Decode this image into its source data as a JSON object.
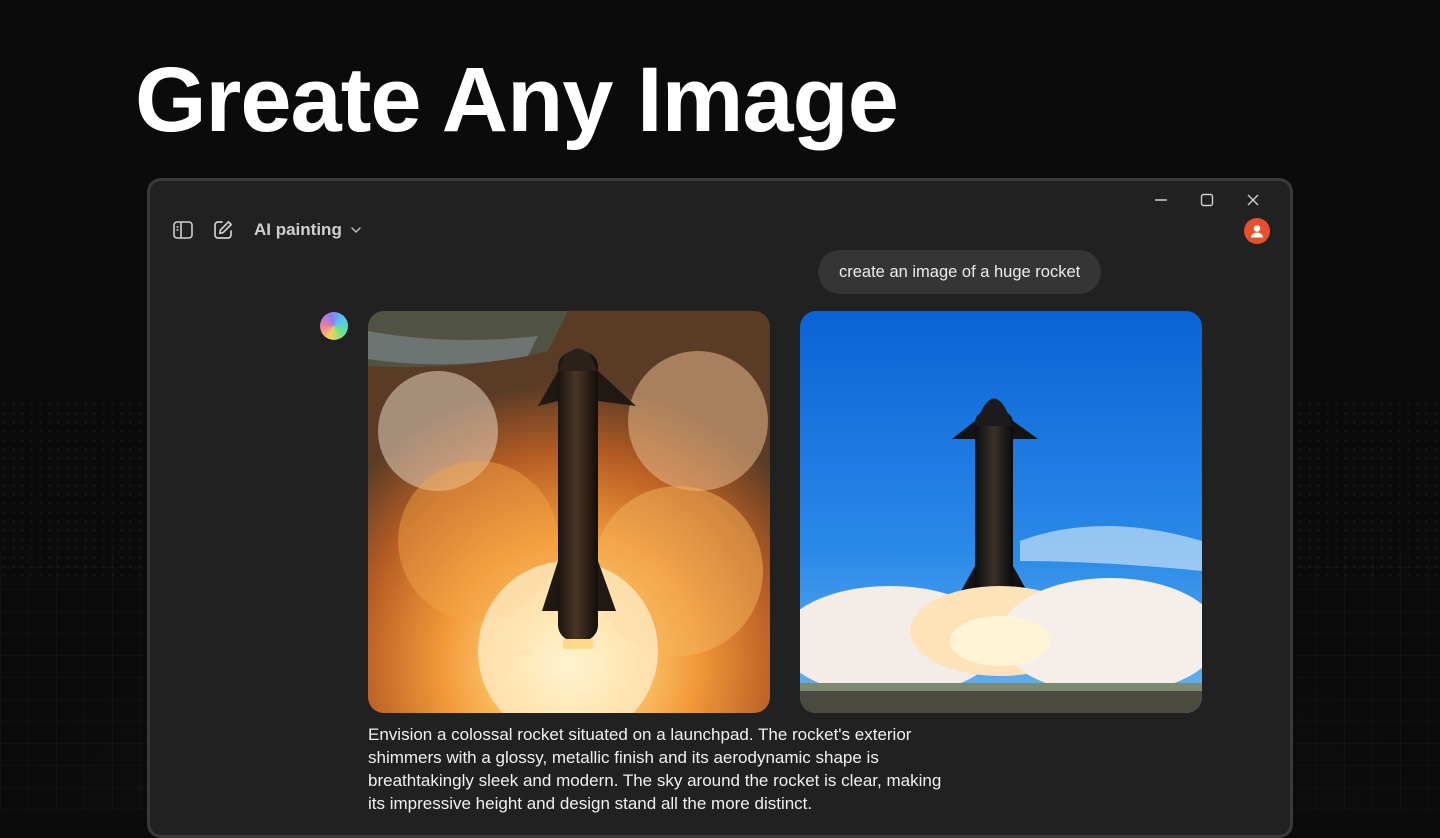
{
  "headline": "Greate Any Image",
  "window": {
    "controls": [
      {
        "name": "minimize-icon"
      },
      {
        "name": "maximize-icon"
      },
      {
        "name": "close-icon"
      }
    ],
    "toolbar": {
      "sidebar_toggle_icon": "sidebar-toggle-icon",
      "new_chat_icon": "edit-icon",
      "model_label": "AI painting"
    },
    "user_avatar_color": "#e6512d"
  },
  "chat": {
    "user_message": "create an image of a huge rocket",
    "images": [
      {
        "name": "rocket-launch-fire-image",
        "scene": "rocket lifting off amid orange fire and smoke"
      },
      {
        "name": "rocket-launch-blue-sky-image",
        "scene": "rocket lifting off against blue sky with white smoke"
      }
    ],
    "response_text": "Envision a colossal rocket situated on a launchpad. The rocket's exterior shimmers with a glossy, metallic finish and its aerodynamic shape is breathtakingly sleek and modern. The sky around the rocket is clear, making its impressive height and design stand all the more distinct."
  },
  "colors": {
    "page_bg": "#0b0b0b",
    "window_bg": "#212121",
    "bubble_bg": "#353535",
    "accent": "#e6512d"
  }
}
